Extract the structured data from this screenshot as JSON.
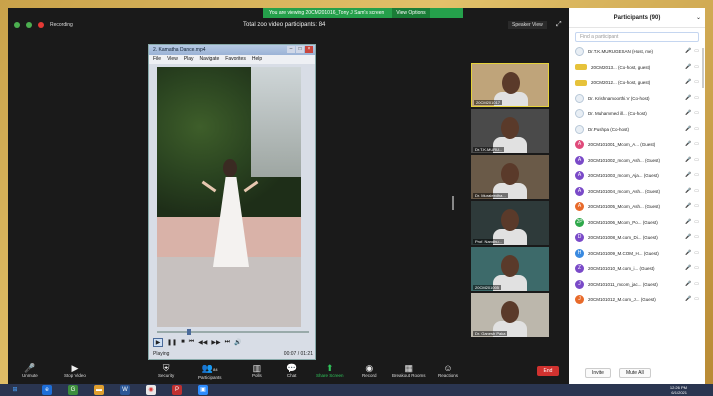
{
  "meeting": {
    "share_banner": "You are viewing 20CM201016_Tony J Sam's screen",
    "view_options": "View Options",
    "recording": "Recording",
    "participants_count_label": "Total zoo video participants: 84",
    "speaker_view": "Speaker View"
  },
  "player": {
    "title": "2. Kamatha Dance.mp4",
    "menu": [
      "File",
      "View",
      "Play",
      "Navigate",
      "Favorites",
      "Help"
    ],
    "status": "Playing",
    "time": "00:07 / 01:21"
  },
  "thumbnails": [
    {
      "name": "20CM201017"
    },
    {
      "name": "Dr.T.K.MURU..."
    },
    {
      "name": "Dr. Muraleedha..."
    },
    {
      "name": "Prof. Nandhu..."
    },
    {
      "name": "20CM201005"
    },
    {
      "name": "Dr. Ganesh Paka"
    }
  ],
  "toolbar": {
    "items": [
      "Unmute",
      "Stop Video",
      "Security",
      "Participants",
      "Polls",
      "Chat",
      "Share Screen",
      "Record",
      "Breakout Rooms",
      "Reactions"
    ],
    "participants_count": "84",
    "end": "End"
  },
  "participants_panel": {
    "title": "Participants (90)",
    "search_placeholder": "Find a participant",
    "rows": [
      {
        "name": "Dr.T.K.MURUGESAN (Host, me)",
        "avatar": "img",
        "color": "#e8eef4",
        "letter": ""
      },
      {
        "name": "20CM2013... (Co-host, guest)",
        "avatar": "badge",
        "color": "#e6c23a",
        "letter": ""
      },
      {
        "name": "20CM2012... (Co-host, guest)",
        "avatar": "badge",
        "color": "#e6c23a",
        "letter": ""
      },
      {
        "name": "Dr. Krishnamoorthi.V (Co-host)",
        "avatar": "img",
        "color": "#e8eef4",
        "letter": ""
      },
      {
        "name": "Dr. Muhammed ill... (Co-host)",
        "avatar": "img",
        "color": "#e8eef4",
        "letter": ""
      },
      {
        "name": "Dr.Pushpa (Co-host)",
        "avatar": "img",
        "color": "#e8eef4",
        "letter": ""
      },
      {
        "name": "20CM101001_Mcom_A... (Guest)",
        "avatar": "letter",
        "color": "#e04a7a",
        "letter": "A"
      },
      {
        "name": "20CM101002_mcom_Ash... (Guest)",
        "avatar": "letter",
        "color": "#7a4ac8",
        "letter": "A"
      },
      {
        "name": "20CM101003_mcom_Aja... (Guest)",
        "avatar": "letter",
        "color": "#7a4ac8",
        "letter": "A"
      },
      {
        "name": "20CM101004_mcom_Ash... (Guest)",
        "avatar": "letter",
        "color": "#7a4ac8",
        "letter": "A"
      },
      {
        "name": "20CM101005_Mcom_Ash... (Guest)",
        "avatar": "letter",
        "color": "#e86a2a",
        "letter": "A"
      },
      {
        "name": "20CM101006_Mcom_Po... (Guest)",
        "avatar": "letter",
        "color": "#2ea84a",
        "letter": "2P"
      },
      {
        "name": "20CM101008_M.com_Di... (Guest)",
        "avatar": "letter",
        "color": "#7a4ac8",
        "letter": "D"
      },
      {
        "name": "20CM101009_M.COM_H... (Guest)",
        "avatar": "letter",
        "color": "#3a8ae0",
        "letter": "H"
      },
      {
        "name": "20CM101010_M.com_i... (Guest)",
        "avatar": "letter",
        "color": "#7a4ac8",
        "letter": "Z"
      },
      {
        "name": "20CM101011_mcom_jac... (Guest)",
        "avatar": "letter",
        "color": "#7a4ac8",
        "letter": "J"
      },
      {
        "name": "20CM101012_M.com_J... (Guest)",
        "avatar": "letter",
        "color": "#e86a2a",
        "letter": "J"
      }
    ],
    "invite": "Invite",
    "mute_all": "Mute All"
  },
  "taskbar": {
    "time": "12:26 PM",
    "date": "6/1/2021"
  }
}
